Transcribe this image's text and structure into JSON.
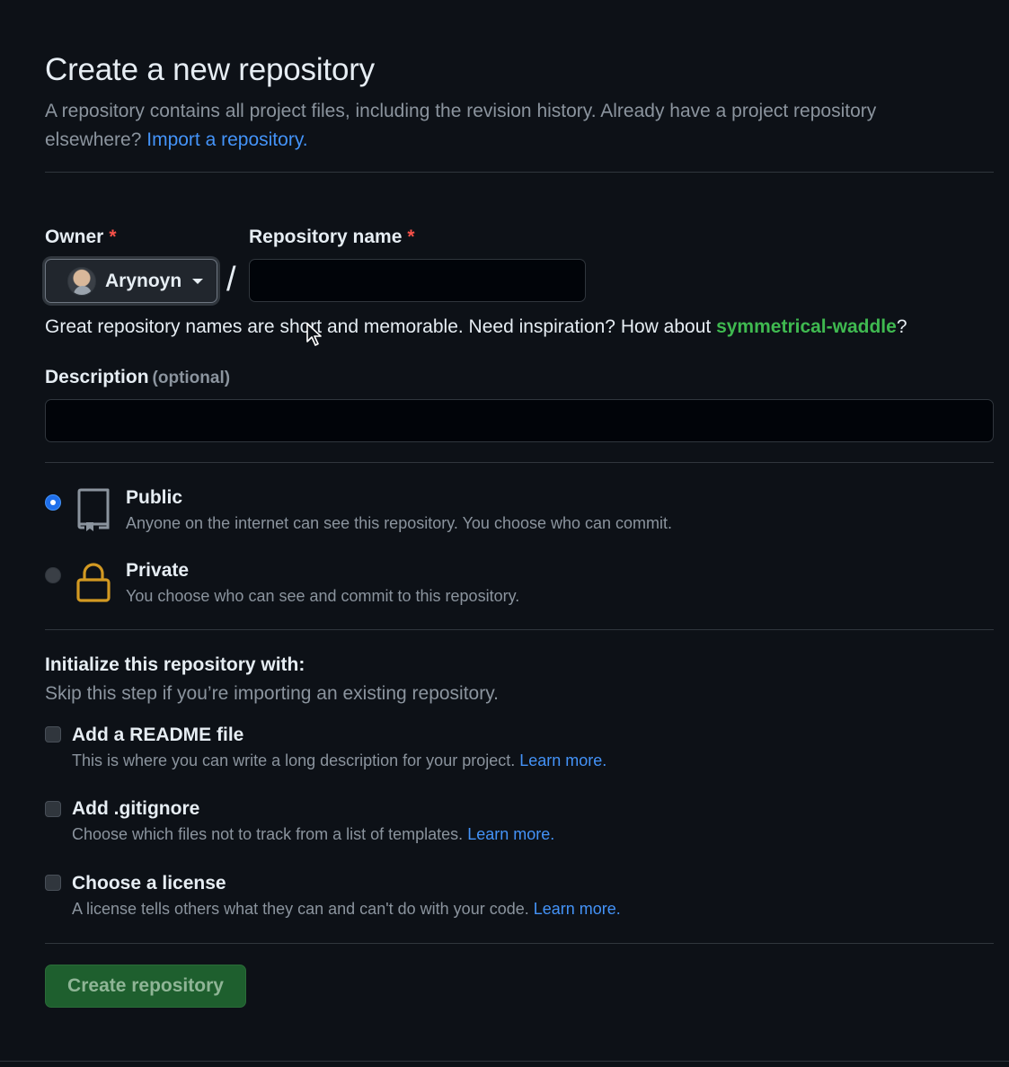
{
  "header": {
    "title": "Create a new repository",
    "intro_text": "A repository contains all project files, including the revision history. Already have a project repository elsewhere?",
    "import_link": "Import a repository."
  },
  "owner": {
    "label": "Owner",
    "required_mark": "*",
    "selected": "Arynoyn"
  },
  "separator": "/",
  "repo_name": {
    "label": "Repository name",
    "required_mark": "*",
    "value": "",
    "help_prefix": "Great repository names are short and memorable. Need inspiration? How about",
    "suggestion": "symmetrical-waddle",
    "help_suffix": "?"
  },
  "description": {
    "label": "Description",
    "optional_text": "(optional)",
    "value": ""
  },
  "visibility": {
    "selected": "public",
    "options": [
      {
        "id": "public",
        "title": "Public",
        "desc": "Anyone on the internet can see this repository. You choose who can commit.",
        "icon": "repo-icon"
      },
      {
        "id": "private",
        "title": "Private",
        "desc": "You choose who can see and commit to this repository.",
        "icon": "lock-icon"
      }
    ]
  },
  "initialize": {
    "title": "Initialize this repository with:",
    "subtitle": "Skip this step if you’re importing an existing repository.",
    "options": [
      {
        "title": "Add a README file",
        "desc": "This is where you can write a long description for your project.",
        "link": "Learn more.",
        "checked": false
      },
      {
        "title": "Add .gitignore",
        "desc": "Choose which files not to track from a list of templates.",
        "link": "Learn more.",
        "checked": false
      },
      {
        "title": "Choose a license",
        "desc": "A license tells others what they can and can't do with your code.",
        "link": "Learn more.",
        "checked": false
      }
    ]
  },
  "submit": {
    "label": "Create repository"
  },
  "colors": {
    "background": "#0d1117",
    "accent_link": "#4493f8",
    "suggestion_green": "#3fb950",
    "required_red": "#f85149",
    "lock_icon": "#d29922",
    "button_green": "#1e5f2e"
  }
}
